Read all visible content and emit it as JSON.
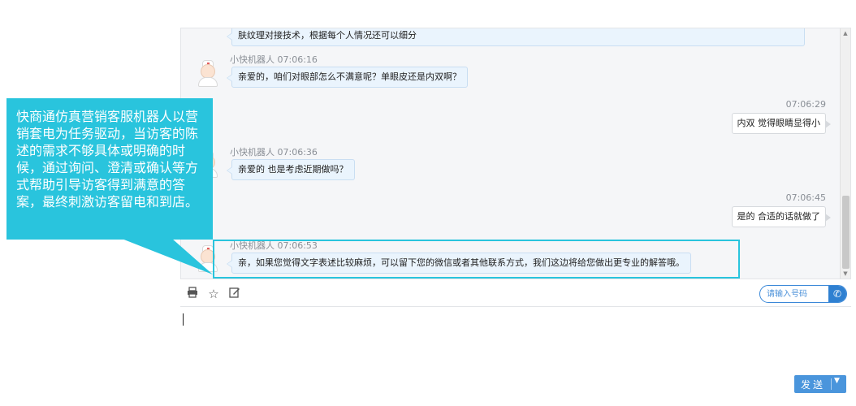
{
  "chat": {
    "top_message_partial": "肤纹理对接技术，根据每个人情况还可以细分",
    "messages": [
      {
        "sender": "小快机器人 07:06:16",
        "text": "亲爱的，咱们对眼部怎么不满意呢？单眼皮还是内双啊？"
      },
      {
        "time": "07:06:29",
        "text": "内双 觉得眼睛显得小"
      },
      {
        "sender": "小快机器人 07:06:36",
        "text": "亲爱的 也是考虑近期做吗？"
      },
      {
        "time": "07:06:45",
        "text": "是的 合适的话就做了"
      },
      {
        "sender": "小快机器人 07:06:53",
        "text": "亲，如果您觉得文字表述比较麻烦，可以留下您的微信或者其他联系方式，我们这边将给您做出更专业的解答哦。"
      }
    ]
  },
  "toolbar": {
    "icons": [
      "print-icon",
      "star-icon",
      "edit-icon"
    ],
    "phone_placeholder": "请输入号码"
  },
  "composer": {
    "send_label": "发送",
    "dropdown_glyph": "▼"
  },
  "callout": {
    "text": "快商通仿真营销客服机器人以营销套电为任务驱动，当访客的陈述的需求不够具体或明确的时候，通过询问、澄清或确认等方式帮助引导访客得到满意的答案，最终刺激访客留电和到店。"
  },
  "colors": {
    "accent_cyan": "#29c4dd",
    "send_blue": "#4a95dc",
    "bot_bubble": "#eaf4fd"
  }
}
